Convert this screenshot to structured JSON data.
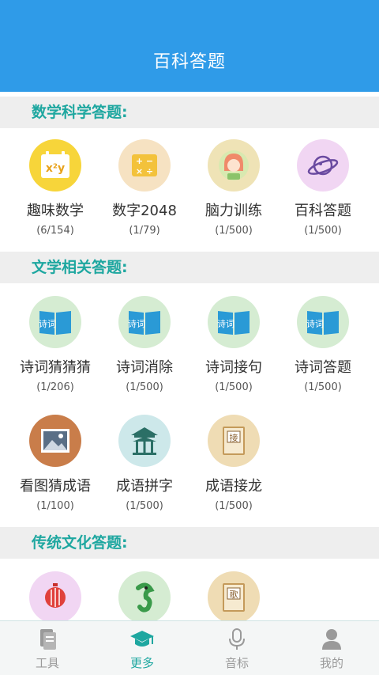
{
  "header": {
    "title": "百科答题"
  },
  "sections": [
    {
      "title": "数学科学答题:",
      "items": [
        {
          "name": "趣味数学",
          "count": "(6/154)",
          "icon": "math-formula-icon"
        },
        {
          "name": "数字2048",
          "count": "(1/79)",
          "icon": "calculator-icon"
        },
        {
          "name": "脑力训练",
          "count": "(1/500)",
          "icon": "girl-avatar-icon"
        },
        {
          "name": "百科答题",
          "count": "(1/500)",
          "icon": "planet-icon"
        }
      ]
    },
    {
      "title": "文学相关答题:",
      "items": [
        {
          "name": "诗词猜猜猜",
          "count": "(1/206)",
          "icon": "poetry-book-icon",
          "book_text": "诗词"
        },
        {
          "name": "诗词消除",
          "count": "(1/500)",
          "icon": "poetry-book-icon",
          "book_text": "诗词"
        },
        {
          "name": "诗词接句",
          "count": "(1/500)",
          "icon": "poetry-book-icon",
          "book_text": "诗词"
        },
        {
          "name": "诗词答题",
          "count": "(1/500)",
          "icon": "poetry-book-icon",
          "book_text": "诗词"
        },
        {
          "name": "看图猜成语",
          "count": "(1/100)",
          "icon": "picture-icon"
        },
        {
          "name": "成语拼字",
          "count": "(1/500)",
          "icon": "pavilion-icon"
        },
        {
          "name": "成语接龙",
          "count": "(1/500)",
          "icon": "jie-book-icon",
          "book_text": "接"
        }
      ]
    },
    {
      "title": "传统文化答题:",
      "items": [
        {
          "name": "",
          "count": "",
          "icon": "lantern-icon"
        },
        {
          "name": "",
          "count": "",
          "icon": "dragon-icon"
        },
        {
          "name": "",
          "count": "",
          "icon": "song-book-icon",
          "book_text": "歌"
        }
      ]
    }
  ],
  "tabs": [
    {
      "label": "工具",
      "icon": "document-icon",
      "active": false
    },
    {
      "label": "更多",
      "icon": "graduation-cap-icon",
      "active": true
    },
    {
      "label": "音标",
      "icon": "microphone-icon",
      "active": false
    },
    {
      "label": "我的",
      "icon": "user-icon",
      "active": false
    }
  ],
  "colors": {
    "header": "#2f9be8",
    "accent": "#1ea7a0",
    "tab_inactive": "#9a9a9a"
  }
}
